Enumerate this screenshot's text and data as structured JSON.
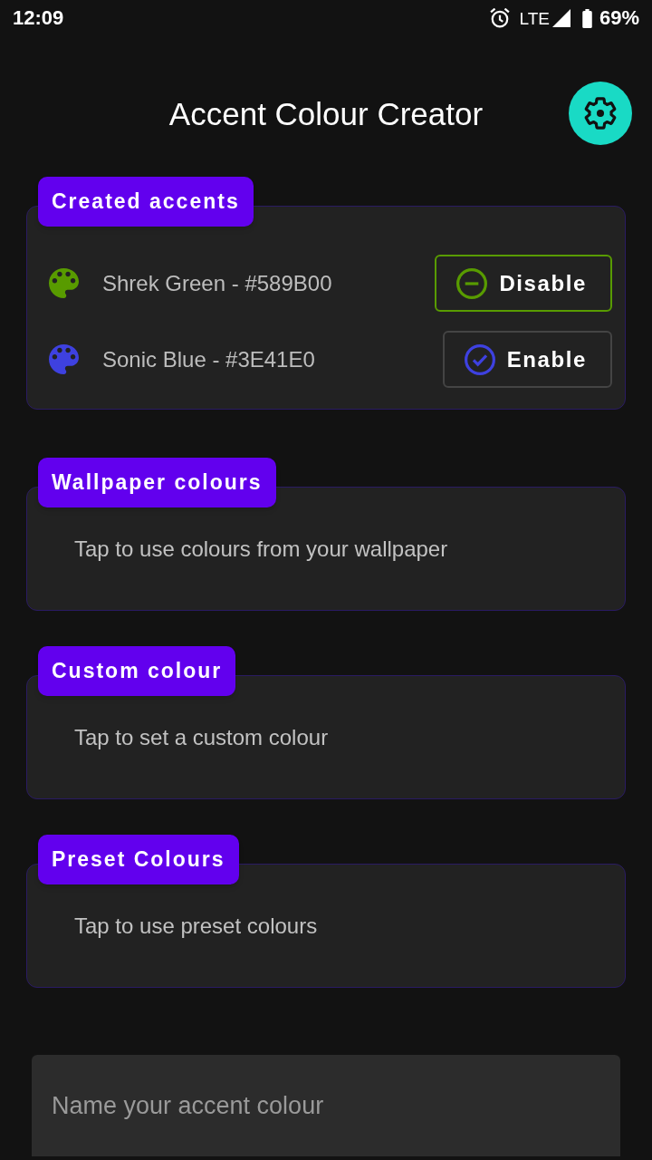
{
  "status_bar": {
    "time": "12:09",
    "network": "LTE",
    "battery": "69%"
  },
  "header": {
    "title": "Accent Colour Creator"
  },
  "sections": [
    {
      "kind": "accent_list",
      "title": "Created accents",
      "accents": [
        {
          "name": "Shrek Green - #589B00",
          "color": "#589b00",
          "enabled": true,
          "action": "Disable"
        },
        {
          "name": "Sonic Blue - #3E41E0",
          "color": "#3e41e0",
          "enabled": false,
          "action": "Enable"
        }
      ]
    },
    {
      "kind": "option",
      "title": "Wallpaper colours",
      "description": "Tap to use colours from your wallpaper"
    },
    {
      "kind": "option",
      "title": "Custom colour",
      "description": "Tap to set a custom colour"
    },
    {
      "kind": "option",
      "title": "Preset Colours",
      "description": "Tap to use preset colours"
    }
  ],
  "name_field": {
    "placeholder": "Name your accent colour"
  }
}
